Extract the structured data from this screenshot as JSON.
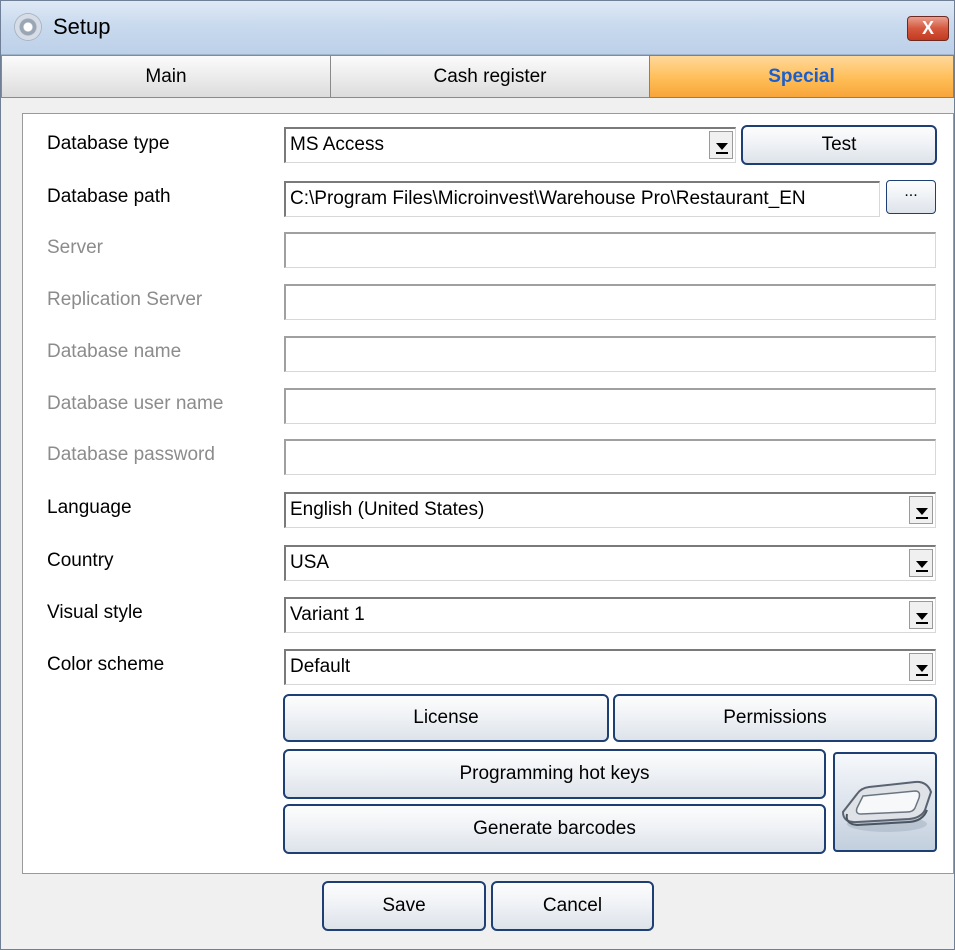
{
  "window": {
    "title": "Setup",
    "close_label": "X"
  },
  "tabs": [
    {
      "label": "Main",
      "active": false
    },
    {
      "label": "Cash register",
      "active": false
    },
    {
      "label": "Special",
      "active": true
    }
  ],
  "form": {
    "database_type": {
      "label": "Database type",
      "value": "MS Access",
      "test_label": "Test"
    },
    "database_path": {
      "label": "Database path",
      "value": "C:\\Program Files\\Microinvest\\Warehouse Pro\\Restaurant_EN",
      "browse_label": "..."
    },
    "server": {
      "label": "Server",
      "value": ""
    },
    "replication_server": {
      "label": "Replication Server",
      "value": ""
    },
    "database_name": {
      "label": "Database name",
      "value": ""
    },
    "database_user_name": {
      "label": "Database user name",
      "value": ""
    },
    "database_password": {
      "label": "Database password",
      "value": ""
    },
    "language": {
      "label": "Language",
      "value": "English (United States)"
    },
    "country": {
      "label": "Country",
      "value": "USA"
    },
    "visual_style": {
      "label": "Visual style",
      "value": "Variant 1"
    },
    "color_scheme": {
      "label": "Color scheme",
      "value": "Default"
    }
  },
  "buttons": {
    "license": "License",
    "permissions": "Permissions",
    "programming_hot_keys": "Programming hot keys",
    "generate_barcodes": "Generate barcodes",
    "keyboard_icon": "keyboard-device-icon",
    "save": "Save",
    "cancel": "Cancel"
  },
  "colors": {
    "active_tab_bg": "#ffbe57",
    "active_tab_text": "#1a5fcc",
    "button_border": "#1e3f73",
    "close_button": "#d5583e",
    "disabled_label": "#8c8c8c"
  }
}
